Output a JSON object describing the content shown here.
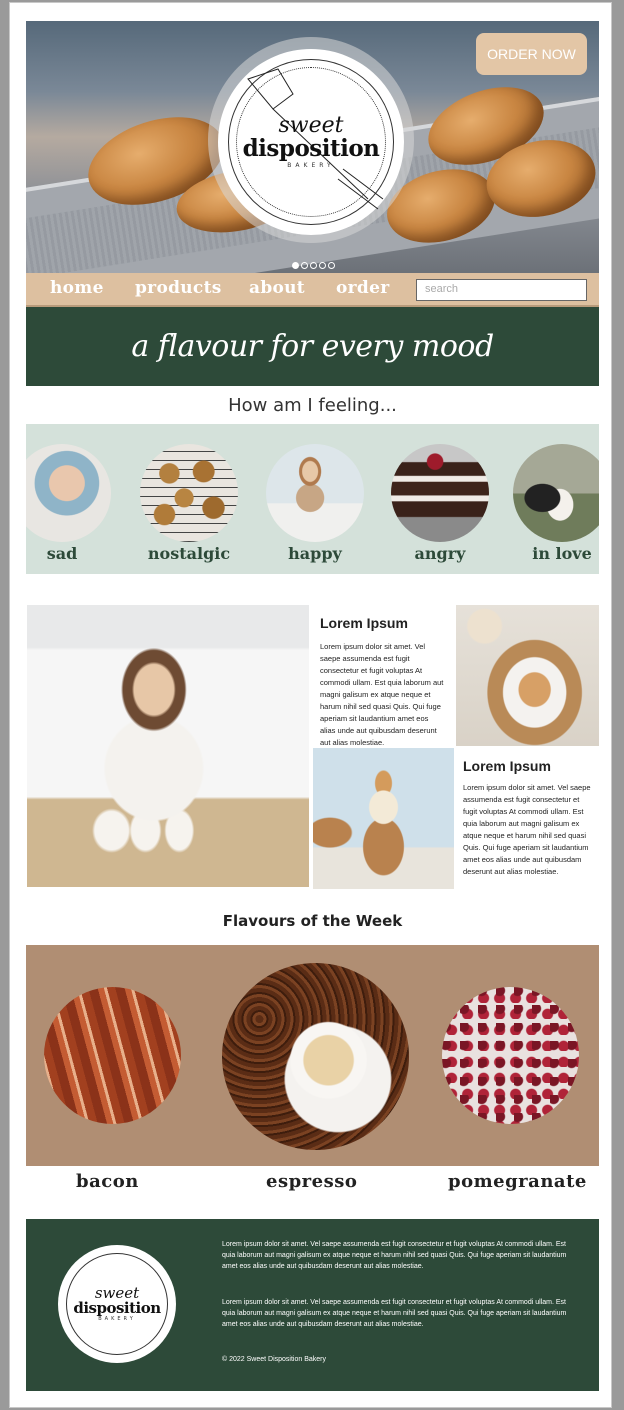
{
  "header": {
    "logo": {
      "line1": "sweet",
      "line2": "disposition",
      "line3": "BAKERY"
    },
    "order_button": "ORDER NOW",
    "slider": {
      "count": 5,
      "active": 1
    }
  },
  "nav": {
    "items": [
      {
        "label": "home"
      },
      {
        "label": "products"
      },
      {
        "label": "about"
      },
      {
        "label": "order"
      }
    ],
    "search_placeholder": "search"
  },
  "tagline": "a flavour for every mood",
  "moods": {
    "title": "How am I feeling...",
    "items": [
      {
        "label": "sad"
      },
      {
        "label": "nostalgic"
      },
      {
        "label": "happy"
      },
      {
        "label": "angry"
      },
      {
        "label": "in love"
      }
    ]
  },
  "features": [
    {
      "title": "Lorem Ipsum",
      "body": "Lorem ipsum dolor sit amet. Vel saepe assumenda est fugit consectetur et fugit voluptas At commodi ullam. Est quia laborum aut magni galisum ex atque neque et harum nihil sed quasi Quis. Qui fuge aperiam sit laudantium amet eos alias unde aut quibusdam deserunt aut alias molestiae."
    },
    {
      "title": "Lorem Ipsum",
      "body": "Lorem ipsum dolor sit amet. Vel saepe assumenda est fugit consectetur et fugit voluptas At commodi ullam. Est quia laborum aut magni galisum ex atque neque et harum nihil sed quasi Quis. Qui fuge aperiam sit laudantium amet eos alias unde aut quibusdam deserunt aut alias molestiae."
    }
  ],
  "flavours": {
    "title": "Flavours of the Week",
    "items": [
      {
        "label": "bacon"
      },
      {
        "label": "espresso"
      },
      {
        "label": "pomegranate"
      }
    ]
  },
  "footer": {
    "paragraph1": "Lorem ipsum dolor sit amet. Vel saepe assumenda est fugit consectetur et fugit voluptas At commodi ullam. Est quia laborum aut magni galisum ex atque neque et harum nihil sed quasi Quis. Qui fuge aperiam sit laudantium amet eos alias unde aut quibusdam deserunt aut alias molestiae.",
    "paragraph2": "Lorem ipsum dolor sit amet. Vel saepe assumenda est fugit consectetur et fugit voluptas At commodi ullam. Est quia laborum aut magni galisum ex atque neque et harum nihil sed quasi Quis. Qui fuge aperiam sit laudantium amet eos alias unde aut quibusdam deserunt aut alias molestiae.",
    "copyright": "© 2022 Sweet Disposition Bakery"
  },
  "colors": {
    "forest_green": "#2d4a39",
    "sand": "#ddc0a0",
    "mint": "#d4e1da",
    "latte": "#b08e73",
    "order_button": "#e3c6a6"
  }
}
